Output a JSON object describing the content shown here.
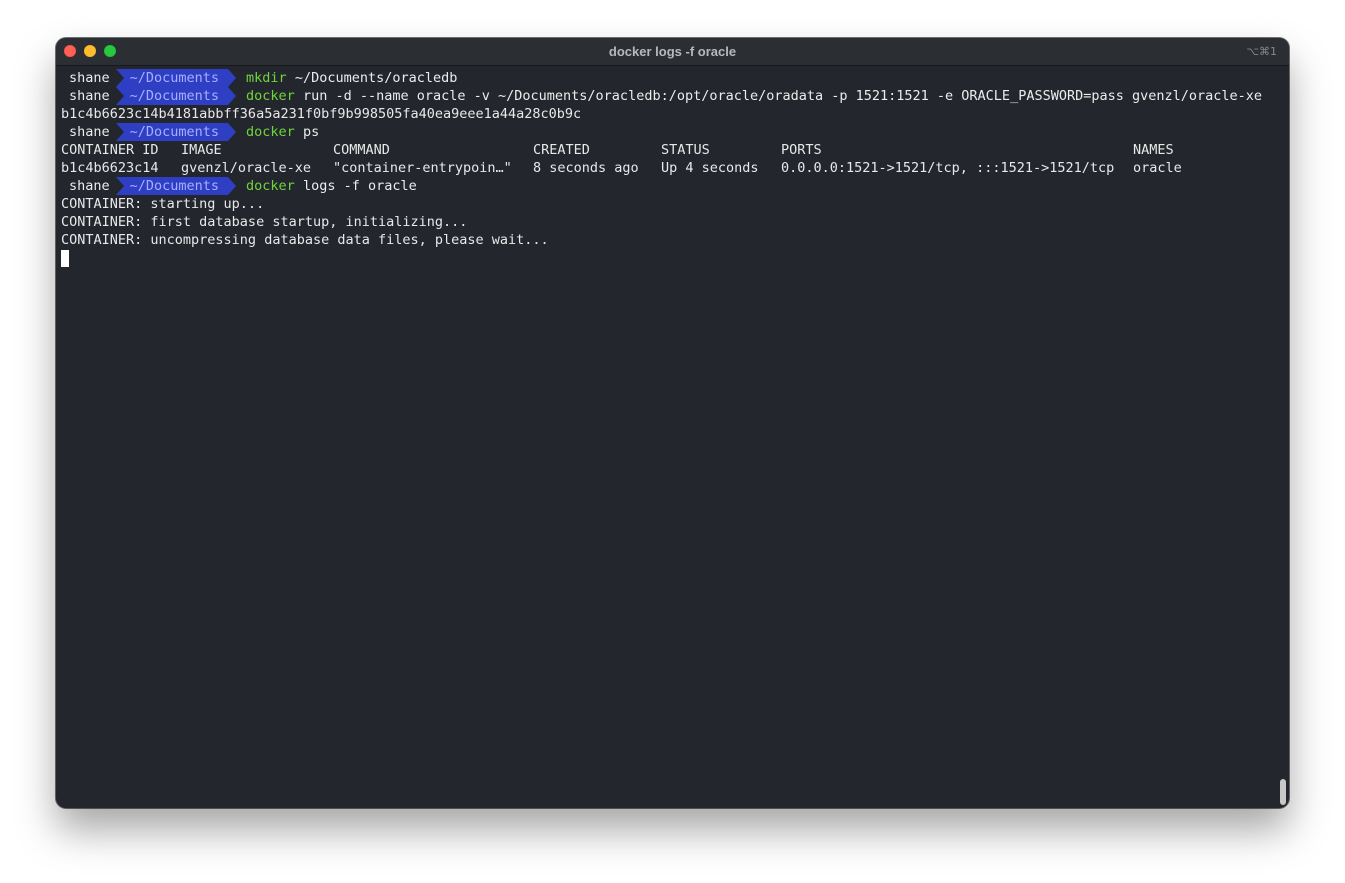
{
  "window": {
    "title": "docker logs -f oracle",
    "shortcut": "⌥⌘1"
  },
  "prompt": {
    "user": "shane",
    "dir": "~/Documents"
  },
  "lines": {
    "l1": {
      "cmd": "mkdir",
      "args": " ~/Documents/oracledb"
    },
    "l2": {
      "cmd": "docker",
      "args": " run -d --name oracle -v ~/Documents/oracledb:/opt/oracle/oradata -p 1521:1521 -e ORACLE_PASSWORD=pass gvenzl/oracle-xe"
    },
    "l3": "b1c4b6623c14b4181abbff36a5a231f0bf9b998505fa40ea9eee1a44a28c0b9c",
    "l4": {
      "cmd": "docker",
      "args": " ps"
    },
    "l7": {
      "cmd": "docker",
      "args": " logs -f oracle"
    },
    "l8": "CONTAINER: starting up...",
    "l9": "CONTAINER: first database startup, initializing...",
    "l10": "CONTAINER: uncompressing database data files, please wait..."
  },
  "ps_table": {
    "headers": [
      "CONTAINER ID",
      "IMAGE",
      "COMMAND",
      "CREATED",
      "STATUS",
      "PORTS",
      "NAMES"
    ],
    "row": [
      "b1c4b6623c14",
      "gvenzl/oracle-xe",
      "\"container-entrypoin…\"",
      "8 seconds ago",
      "Up 4 seconds",
      "0.0.0.0:1521->1521/tcp, :::1521->1521/tcp",
      "oracle"
    ]
  }
}
